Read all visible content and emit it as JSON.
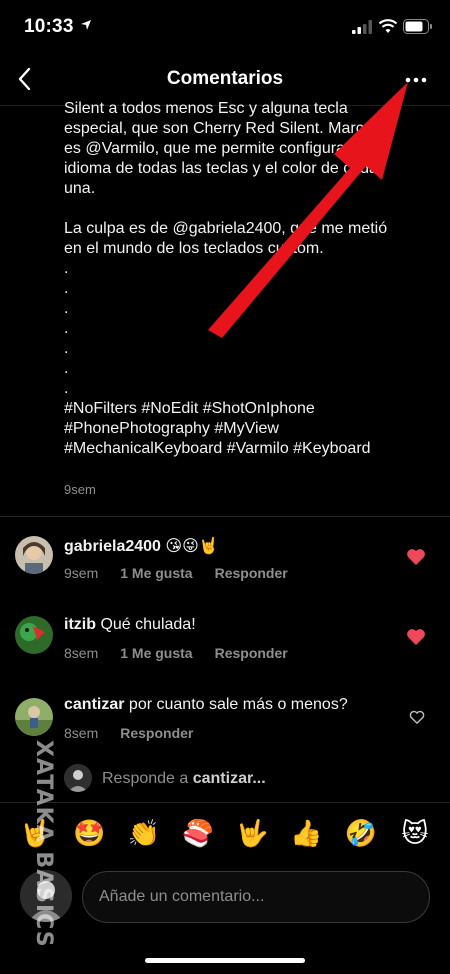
{
  "status_bar": {
    "time": "10:33"
  },
  "header": {
    "title": "Comentarios"
  },
  "caption": {
    "lines": [
      "Silent a todos menos Esc y alguna tecla",
      "especial, que son Cherry Red Silent. Marca",
      "es @Varmilo, que me permite configurar el",
      "idioma de todas las teclas y el color de cada",
      "una.",
      "",
      "La culpa es de @gabriela2400, que me metió",
      "en el mundo de los teclados custom.",
      ".",
      ".",
      ".",
      ".",
      ".",
      ".",
      ".",
      "#NoFilters #NoEdit #ShotOnIphone",
      "#PhonePhotography #MyView",
      "#MechanicalKeyboard #Varmilo #Keyboard"
    ],
    "time": "9sem"
  },
  "comments": [
    {
      "user": "gabriela2400",
      "text": "😘😜🤘",
      "time": "9sem",
      "likes": "1 Me gusta",
      "reply": "Responder",
      "liked": true
    },
    {
      "user": "itzib",
      "text": "Qué chulada!",
      "time": "8sem",
      "likes": "1 Me gusta",
      "reply": "Responder",
      "liked": true
    },
    {
      "user": "cantizar",
      "text": "por cuanto sale más o menos?",
      "time": "8sem",
      "likes": "",
      "reply": "Responder",
      "liked": false
    }
  ],
  "reply_prompt": {
    "prefix": "Responde a ",
    "user": "cantizar..."
  },
  "emoji_bar": [
    "🤘",
    "🤩",
    "👏",
    "🍣",
    "🤟",
    "👍",
    "🤣",
    "😻"
  ],
  "input": {
    "placeholder": "Añade un comentario..."
  },
  "watermark": "XATAKA BASICS",
  "colors": {
    "accent_heart": "#ed4956",
    "arrow": "#e8141c"
  }
}
